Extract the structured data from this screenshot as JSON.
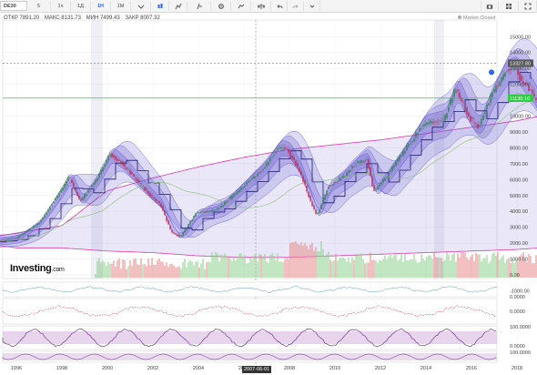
{
  "toolbar": {
    "symbol": "DE30",
    "intervals": [
      "5",
      "1ч",
      "1Д",
      "1Н",
      "1М"
    ],
    "active_interval": "1Н"
  },
  "ohlc": {
    "open": "ОТКР 7891.20",
    "high": "МАКС 8131.73",
    "low": "МИН 7499.43",
    "close": "ЗАКР 8007.32"
  },
  "market_status": "Market Closed",
  "logo": {
    "main": "Investing",
    "suffix": ".com"
  },
  "price_axis": {
    "ticks": [
      "15000.00",
      "14000.00",
      "13000.00",
      "12000.00",
      "11000.00",
      "10000.00",
      "9000.00",
      "8000.00",
      "7000.00",
      "6000.00",
      "5000.00",
      "4000.00",
      "3000.00",
      "2000.00",
      "1000.00",
      "0.00",
      "-1000.00"
    ],
    "current_price": "13327.80",
    "level_price": "11130.10"
  },
  "indicator_axes": {
    "ind1": [
      "0.0000"
    ],
    "ind2": [
      "0.0000"
    ],
    "ind3": [
      "100.0000",
      "0.0000"
    ],
    "ind4": [
      "100.0000"
    ]
  },
  "time_axis": {
    "labels": [
      "1996",
      "1998",
      "2000",
      "2002",
      "2004",
      "2006",
      "2008",
      "2010",
      "2012",
      "2014",
      "2016",
      "2018"
    ],
    "crosshair_label": "2007-06-01"
  },
  "colors": {
    "up_candle": "#1f7a3e",
    "down_candle": "#c0143c",
    "band_fill": "#6b5ed0",
    "envelope": "#d83aa8",
    "current_price": "#2962ff",
    "level_line": "#2ecc40"
  },
  "chart_data": {
    "type": "candlestick",
    "price_anchors": [
      [
        1995.0,
        2100
      ],
      [
        1996.0,
        2300
      ],
      [
        1997.0,
        3300
      ],
      [
        1998.0,
        5400
      ],
      [
        1998.3,
        6200
      ],
      [
        1998.8,
        4600
      ],
      [
        1999.5,
        6000
      ],
      [
        2000.1,
        7600
      ],
      [
        2000.6,
        7100
      ],
      [
        2001.2,
        6100
      ],
      [
        2001.9,
        5000
      ],
      [
        2002.3,
        4500
      ],
      [
        2002.8,
        2700
      ],
      [
        2003.2,
        2400
      ],
      [
        2003.9,
        3900
      ],
      [
        2004.6,
        4000
      ],
      [
        2005.0,
        4300
      ],
      [
        2005.9,
        5500
      ],
      [
        2006.8,
        6600
      ],
      [
        2007.5,
        8000
      ],
      [
        2007.9,
        7900
      ],
      [
        2008.4,
        6700
      ],
      [
        2008.9,
        4700
      ],
      [
        2009.2,
        3700
      ],
      [
        2009.7,
        5600
      ],
      [
        2010.4,
        6200
      ],
      [
        2010.9,
        7000
      ],
      [
        2011.4,
        7300
      ],
      [
        2011.7,
        5200
      ],
      [
        2012.4,
        6500
      ],
      [
        2013.0,
        7700
      ],
      [
        2013.9,
        9500
      ],
      [
        2014.8,
        9800
      ],
      [
        2015.3,
        11800
      ],
      [
        2015.9,
        9900
      ],
      [
        2016.3,
        9300
      ],
      [
        2016.9,
        11400
      ],
      [
        2017.5,
        12800
      ],
      [
        2017.9,
        13000
      ],
      [
        2018.2,
        12300
      ],
      [
        2018.7,
        11400
      ],
      [
        2018.9,
        10700
      ]
    ],
    "upper_envelope": [
      [
        1995.0,
        2400
      ],
      [
        1998.0,
        3100
      ],
      [
        2000.0,
        5300
      ],
      [
        2002.0,
        6100
      ],
      [
        2004.0,
        6800
      ],
      [
        2006.0,
        7400
      ],
      [
        2008.0,
        7900
      ],
      [
        2010.0,
        8200
      ],
      [
        2012.0,
        8500
      ],
      [
        2014.0,
        8900
      ],
      [
        2016.0,
        9300
      ],
      [
        2018.0,
        9700
      ],
      [
        2019.0,
        10000
      ]
    ],
    "lower_envelope": [
      [
        1995.0,
        1900
      ],
      [
        1996.0,
        1700
      ],
      [
        1998.0,
        1700
      ],
      [
        2000.0,
        1500
      ],
      [
        2002.0,
        1400
      ],
      [
        2004.0,
        1200
      ],
      [
        2006.0,
        1100
      ],
      [
        2008.0,
        1100
      ],
      [
        2010.0,
        1200
      ],
      [
        2012.0,
        1300
      ],
      [
        2014.0,
        1400
      ],
      [
        2016.0,
        1500
      ],
      [
        2018.0,
        1600
      ],
      [
        2019.0,
        1700
      ]
    ]
  }
}
